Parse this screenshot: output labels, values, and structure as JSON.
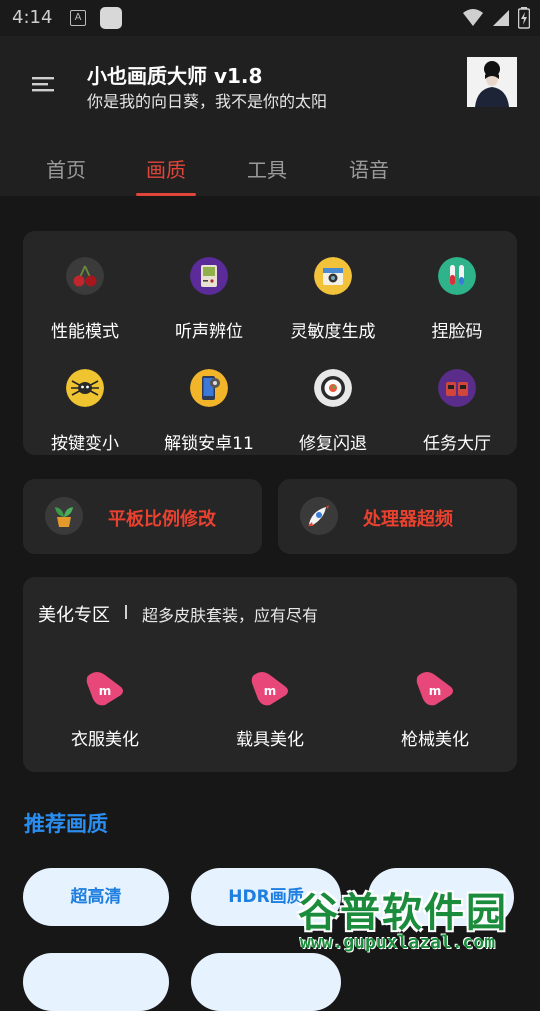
{
  "status_bar": {
    "time": "4:14",
    "a_icon": "A"
  },
  "header": {
    "title": "小也画质大师 v1.8",
    "subtitle": "你是我的向日葵，我不是你的太阳"
  },
  "tabs": [
    {
      "label": "首页",
      "active": false
    },
    {
      "label": "画质",
      "active": true
    },
    {
      "label": "工具",
      "active": false
    },
    {
      "label": "语音",
      "active": false
    }
  ],
  "grid": {
    "items": [
      {
        "label": "性能模式",
        "icon": "cherry-icon"
      },
      {
        "label": "听声辨位",
        "icon": "gameboy-icon"
      },
      {
        "label": "灵敏度生成",
        "icon": "camera-icon"
      },
      {
        "label": "捏脸码",
        "icon": "test-tubes-icon"
      },
      {
        "label": "按键变小",
        "icon": "spider-icon"
      },
      {
        "label": "解锁安卓11",
        "icon": "phone-settings-icon"
      },
      {
        "label": "修复闪退",
        "icon": "sushi-icon"
      },
      {
        "label": "任务大厅",
        "icon": "group-icon"
      }
    ]
  },
  "quick_actions": [
    {
      "label": "平板比例修改",
      "icon": "plant-pot-icon"
    },
    {
      "label": "处理器超频",
      "icon": "rocket-icon"
    }
  ],
  "beauty": {
    "title": "美化专区",
    "subtitle": "超多皮肤套装，应有尽有",
    "items": [
      {
        "label": "衣服美化",
        "icon": "m-logo-icon"
      },
      {
        "label": "载具美化",
        "icon": "m-logo-icon"
      },
      {
        "label": "枪械美化",
        "icon": "m-logo-icon"
      }
    ]
  },
  "recommended": {
    "title": "推荐画质",
    "pills": [
      "超高清",
      "HDR画质"
    ]
  },
  "watermark": {
    "text": "谷普软件园",
    "url": "www.gupuxlazal.com"
  },
  "colors": {
    "accent_red": "#e0453a",
    "accent_blue": "#2a8df0",
    "card_bg": "#262626",
    "page_bg": "#171717"
  }
}
